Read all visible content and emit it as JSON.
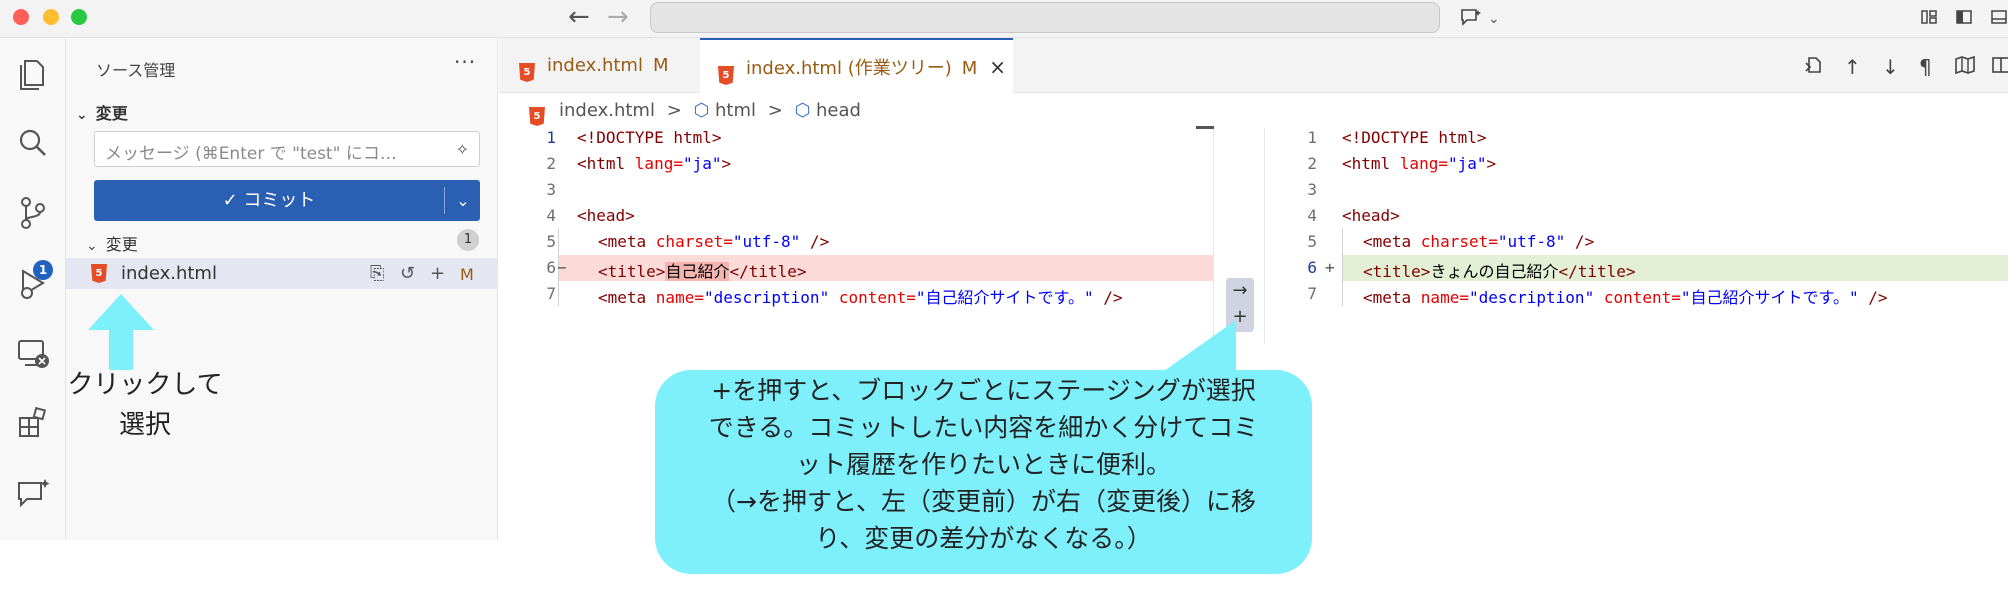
{
  "titlebar": {
    "back": "←",
    "forward": "→"
  },
  "sidebar": {
    "title": "ソース管理",
    "more": "···",
    "section_changes": "変更",
    "message_placeholder": "メッセージ (⌘Enter で \"test\" にコ…",
    "commit_label": "✓ コミット",
    "group_changes": "変更",
    "group_count": "1",
    "file": {
      "name": "index.html",
      "status": "M"
    },
    "activity_badge": "1"
  },
  "editor": {
    "tabs": [
      {
        "label": "index.html",
        "status": "M"
      },
      {
        "label": "index.html (作業ツリー)",
        "status": "M",
        "close": "×"
      }
    ],
    "breadcrumb": {
      "file": "index.html",
      "sep": ">",
      "node1": "html",
      "node2": "head"
    },
    "left": {
      "lines": [
        {
          "n": "1"
        },
        {
          "n": "2"
        },
        {
          "n": "3"
        },
        {
          "n": "4"
        },
        {
          "n": "5"
        },
        {
          "n": "6",
          "marker": "−"
        },
        {
          "n": "7"
        }
      ]
    },
    "right": {
      "lines": [
        {
          "n": "1"
        },
        {
          "n": "2"
        },
        {
          "n": "3"
        },
        {
          "n": "4"
        },
        {
          "n": "5"
        },
        {
          "n": "6",
          "marker": "+"
        },
        {
          "n": "7"
        }
      ]
    },
    "code": {
      "l1": "<!DOCTYPE html>",
      "l2_tag": "<html ",
      "l2_attr": "lang=",
      "l2_val": "\"ja\"",
      "l2_end": ">",
      "l4": "<head>",
      "l5_tag": "<meta ",
      "l5_attr": "charset=",
      "l5_val": "\"utf-8\"",
      "l5_end": " />",
      "l6_old_open": "<title>",
      "l6_old_text": "自己紹介",
      "l6_old_close": "</title>",
      "l6_new_open": "<title>",
      "l6_new_text": "きょんの自己紹介",
      "l6_new_close": "</title>",
      "l7_tag": "<meta ",
      "l7_attr1": "name=",
      "l7_val1": "\"description\"",
      "l7_attr2": " content=",
      "l7_val2": "\"自己紹介サイトです。\"",
      "l7_end": " />"
    },
    "diff_actions": {
      "revert": "→",
      "stage": "+"
    }
  },
  "annotations": {
    "callout_lines": [
      "+を押すと、ブロックごとにステージングが選択",
      "できる。コミットしたい内容を細かく分けてコミ",
      "ット履歴を作りたいときに便利。",
      "（→を押すと、左（変更前）が右（変更後）に移",
      "り、変更の差分がなくなる。）"
    ],
    "click_lines": [
      "クリックして",
      "選択"
    ]
  },
  "colors": {
    "accent": "#2b5fb3",
    "callout": "#7ef0fb",
    "deleted": "#fbdad7",
    "inserted": "#e3f0d6"
  }
}
